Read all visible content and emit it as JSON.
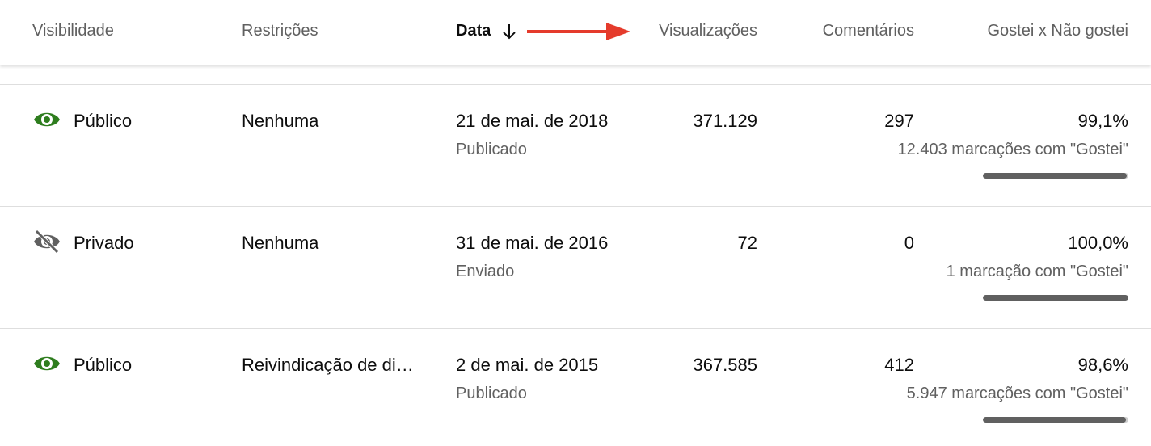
{
  "header": {
    "visibility": "Visibilidade",
    "restrictions": "Restrições",
    "date": "Data",
    "views": "Visualizações",
    "comments": "Comentários",
    "likes": "Gostei x Não gostei"
  },
  "colors": {
    "public_icon": "#2e7d1e",
    "private_icon": "#606060",
    "annotation_arrow": "#e53b2c",
    "like_bar": "#606060"
  },
  "rows": [
    {
      "visibility": "Público",
      "visibility_icon": "eye-icon",
      "restriction": "Nenhuma",
      "date": "21 de mai. de 2018",
      "status": "Publicado",
      "views": "371.129",
      "comments": "297",
      "like_percent": "99,1%",
      "like_count": "12.403 marcações com \"Gostei\"",
      "like_ratio": 0.991
    },
    {
      "visibility": "Privado",
      "visibility_icon": "eye-off-icon",
      "restriction": "Nenhuma",
      "date": "31 de mai. de 2016",
      "status": "Enviado",
      "views": "72",
      "comments": "0",
      "like_percent": "100,0%",
      "like_count": "1 marcação com \"Gostei\"",
      "like_ratio": 1.0
    },
    {
      "visibility": "Público",
      "visibility_icon": "eye-icon",
      "restriction": "Reivindicação de di…",
      "date": "2 de mai. de 2015",
      "status": "Publicado",
      "views": "367.585",
      "comments": "412",
      "like_percent": "98,6%",
      "like_count": "5.947 marcações com \"Gostei\"",
      "like_ratio": 0.986
    }
  ]
}
